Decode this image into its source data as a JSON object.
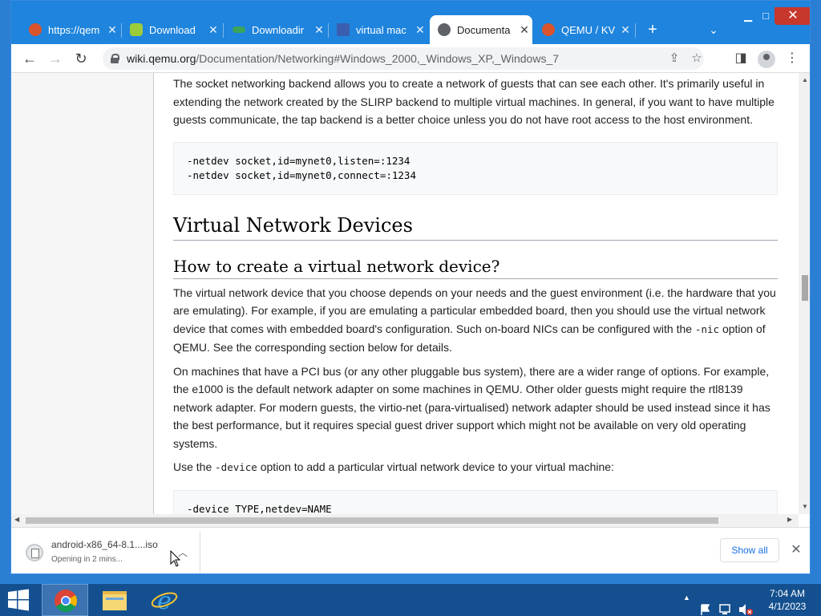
{
  "tabs": [
    {
      "title": "https://qem",
      "favicon_color": "#d9532c",
      "close": "✕"
    },
    {
      "title": "Download",
      "favicon_color": "#9ccc3a",
      "close": "✕"
    },
    {
      "title": "Downloadir",
      "favicon_color": "#3ba55c",
      "close": "✕"
    },
    {
      "title": "virtual mac",
      "favicon_color": "#3b5fb0",
      "close": "✕"
    },
    {
      "title": "Documenta",
      "favicon_color": "#5f6368",
      "close": "✕"
    },
    {
      "title": "QEMU / KV",
      "favicon_color": "#d9532c",
      "close": "✕"
    }
  ],
  "toolbar": {
    "url_host": "wiki.qemu.org",
    "url_path": "/Documentation/Networking#Windows_2000,_Windows_XP,_Windows_7"
  },
  "content": {
    "intro": "The socket networking backend allows you to create a network of guests that can see each other. It's primarily useful in extending the network created by the SLIRP backend to multiple virtual machines. In general, if you want to have multiple guests communicate, the tap backend is a better choice unless you do not have root access to the host environment.",
    "code1": "-netdev socket,id=mynet0,listen=:1234\n-netdev socket,id=mynet0,connect=:1234",
    "h2": "Virtual Network Devices",
    "h3": "How to create a virtual network device?",
    "p1_a": "The virtual network device that you choose depends on your needs and the guest environment (i.e. the hardware that you are emulating). For example, if you are emulating a particular embedded board, then you should use the virtual network device that comes with embedded board's configuration. Such on-board NICs can be configured with the ",
    "p1_code": "-nic",
    "p1_b": " option of QEMU. See the corresponding section below for details.",
    "p2": "On machines that have a PCI bus (or any other pluggable bus system), there are a wider range of options. For example, the e1000 is the default network adapter on some machines in QEMU. Other older guests might require the rtl8139 network adapter. For modern guests, the virtio-net (para-virtualised) network adapter should be used instead since it has the best performance, but it requires special guest driver support which might not be available on very old operating systems.",
    "p3_a": "Use the ",
    "p3_code": "-device",
    "p3_b": " option to add a particular virtual network device to your virtual machine:",
    "code2": "-device TYPE,netdev=NAME"
  },
  "download": {
    "filename": "android-x86_64-8.1....iso",
    "status": "Opening in 2 mins...",
    "show_all": "Show all"
  },
  "taskbar": {
    "time": "7:04 AM",
    "date": "4/1/2023"
  }
}
